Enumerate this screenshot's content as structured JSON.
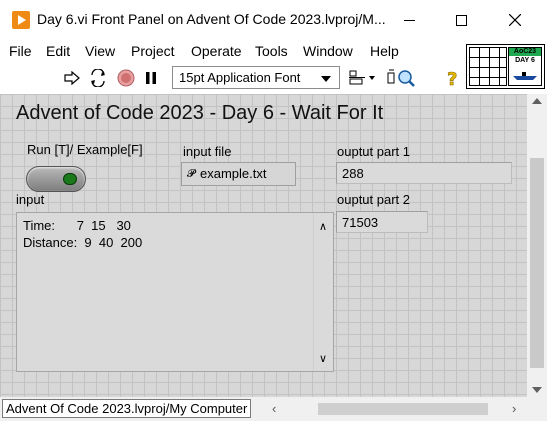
{
  "window": {
    "title": "Day 6.vi Front Panel on Advent Of Code 2023.lvproj/M..."
  },
  "menu": [
    "File",
    "Edit",
    "View",
    "Project",
    "Operate",
    "Tools",
    "Window",
    "Help"
  ],
  "toolbar": {
    "icons": [
      "run-arrow-icon",
      "run-continuously-icon",
      "abort-icon",
      "pause-icon",
      "align-icon",
      "context-help-icon"
    ],
    "font_selector": "15pt Application Font"
  },
  "vi_icon": {
    "band_text": "AoC23",
    "day_text": "DAY 6"
  },
  "panel": {
    "title": "Advent of Code 2023 - Day 6 - Wait For It",
    "run_label": "Run [T]/ Example[F]",
    "input_file_label": "input file",
    "input_file_value": "example.txt",
    "output1_label": "ouptut part 1",
    "output1_value": "288",
    "output2_label": "ouptut part 2",
    "output2_value": "71503",
    "input_label": "input",
    "input_text": "Time:      7  15   30\nDistance:  9  40  200"
  },
  "status": {
    "context": "Advent Of Code 2023.lvproj/My Computer"
  },
  "colors": {
    "app_icon": "#f08a16",
    "panel_bg": "#d7d7d7",
    "run_led": "#1a7a1a",
    "vi_band": "#1fa84f"
  }
}
